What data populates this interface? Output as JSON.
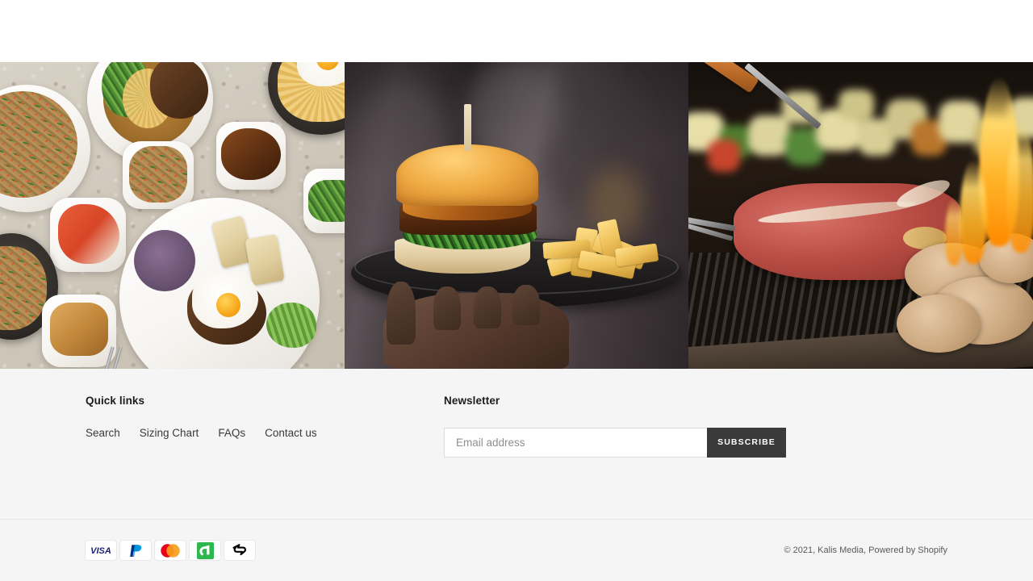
{
  "page": {
    "background_color": "#ffffff",
    "footer_background": "#f5f5f5",
    "accent_dark": "#3a3a3a"
  },
  "gallery": {
    "images": [
      {
        "name": "korean-food-spread",
        "alt": "Overhead view of a Korean meal spread with bibimbap, japchae noodles, kimchi side dishes, fried eggs and stone pots on a speckled stone table"
      },
      {
        "name": "burger-and-fries",
        "alt": "A hand holding a dark round plate with a brioche burger topped with caramelised onion and rocket, served with chunky fries"
      },
      {
        "name": "bbq-grill-steak",
        "alt": "A thick steak searing on a barbecue grill beside vegetable kebab skewers and a coiled sausage with orange flames"
      }
    ]
  },
  "footer": {
    "quick_links": {
      "title": "Quick links",
      "items": [
        {
          "label": "Search"
        },
        {
          "label": "Sizing Chart"
        },
        {
          "label": "FAQs"
        },
        {
          "label": "Contact us"
        }
      ]
    },
    "newsletter": {
      "title": "Newsletter",
      "email_placeholder": "Email address",
      "email_value": "",
      "subscribe_label": "Subscribe"
    },
    "payment_icons": [
      {
        "name": "visa-icon",
        "label": "VISA",
        "colors": [
          "#1a1f71"
        ]
      },
      {
        "name": "paypal-icon",
        "label": "PayPal",
        "colors": [
          "#003087",
          "#009cde"
        ]
      },
      {
        "name": "mastercard-icon",
        "label": "Mastercard",
        "colors": [
          "#eb001b",
          "#f79e1b"
        ]
      },
      {
        "name": "afterpay-icon",
        "label": "Afterpay",
        "colors": [
          "#2db84d"
        ]
      },
      {
        "name": "zip-icon",
        "label": "Zip",
        "colors": [
          "#000000"
        ]
      }
    ],
    "copyright": "© 2021, Kalis Media, Powered by Shopify"
  }
}
